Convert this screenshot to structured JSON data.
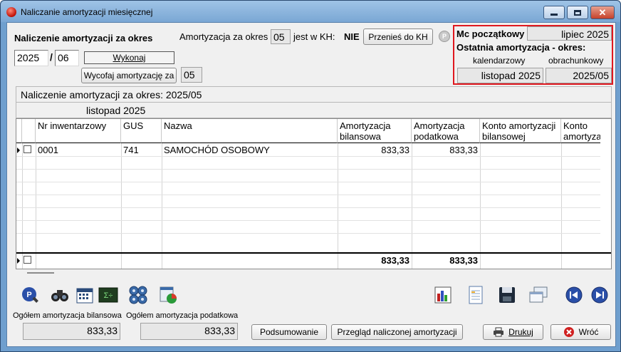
{
  "window": {
    "title": "Naliczanie amortyzacji miesięcznej"
  },
  "header": {
    "heading": "Naliczenie amortyzacji za okres",
    "year": "2025",
    "slash": "/",
    "month": "06",
    "run_button": "Wykonaj",
    "undo_button": "Wycofaj  amortyzację za",
    "undo_value": "05",
    "kh_label_prefix": "Amortyzacja za okres",
    "kh_period": "05",
    "kh_label_suffix": "jest w KH:",
    "kh_status": "NIE",
    "transfer_button": "Przenieś do KH",
    "info_badge": "P"
  },
  "summary_box": {
    "start_label": "Mc początkowy",
    "start_value": "lipiec 2025",
    "last_label": "Ostatnia amortyzacja - okres:",
    "col_calendar": "kalendarzowy",
    "col_fiscal": "obrachunkowy",
    "calendar_value": "listopad 2025",
    "fiscal_value": "2025/05"
  },
  "period_band": "Naliczenie  amortyzacji za okres: 2025/05",
  "month_band": "listopad 2025",
  "table": {
    "columns": [
      "Nr inwentarzowy",
      "GUS",
      "Nazwa",
      "Amortyzacja bilansowa",
      "Amortyzacja podatkowa",
      "Konto amortyzacji bilansowej",
      "Konto amortyza"
    ],
    "rows": [
      {
        "inventory": "0001",
        "gus": "741",
        "name": "SAMOCHÓD OSOBOWY",
        "balance": "833,33",
        "tax": "833,33",
        "account_balance": "",
        "account_tax": ""
      }
    ],
    "totals": {
      "balance": "833,33",
      "tax": "833,33"
    }
  },
  "footer": {
    "balance_caption": "Ogółem amortyzacja bilansowa",
    "balance_total": "833,33",
    "tax_caption": "Ogółem amortyzacja podatkowa",
    "tax_total": "833,33",
    "summary_button": "Podsumowanie",
    "review_button": "Przegląd naliczonej amortyzacji",
    "print_button": "Drukuj",
    "back_button": "Wróć"
  },
  "toolbar": {
    "icons": [
      "search-doc-icon",
      "binoculars-icon",
      "calendar-icon",
      "calculator-icon",
      "gears-icon",
      "pie-report-icon",
      "bar-chart-icon",
      "spreadsheet-icon",
      "save-icon",
      "windows-icon",
      "first-record-icon",
      "last-record-icon"
    ]
  }
}
